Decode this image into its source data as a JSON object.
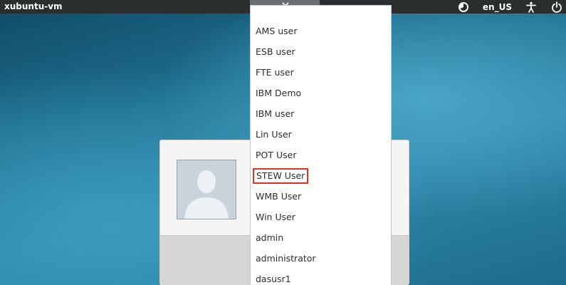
{
  "panel": {
    "hostname": "xubuntu-vm",
    "language": "en_US",
    "icons": [
      "session-indicator-icon",
      "accessibility-icon",
      "power-icon"
    ]
  },
  "dropdown": {
    "toggle_icon": "chevron-down-icon",
    "users": [
      "AMS user",
      "ESB user",
      "FTE user",
      "IBM Demo",
      "IBM user",
      "Lin User",
      "POT User",
      "STEW User",
      "WMB User",
      "Win User",
      "admin",
      "administrator",
      "dasusr1"
    ],
    "highlighted": "STEW User",
    "highlight_color": "#e0301e"
  },
  "login": {
    "avatar_icon": "user-silhouette-icon"
  }
}
